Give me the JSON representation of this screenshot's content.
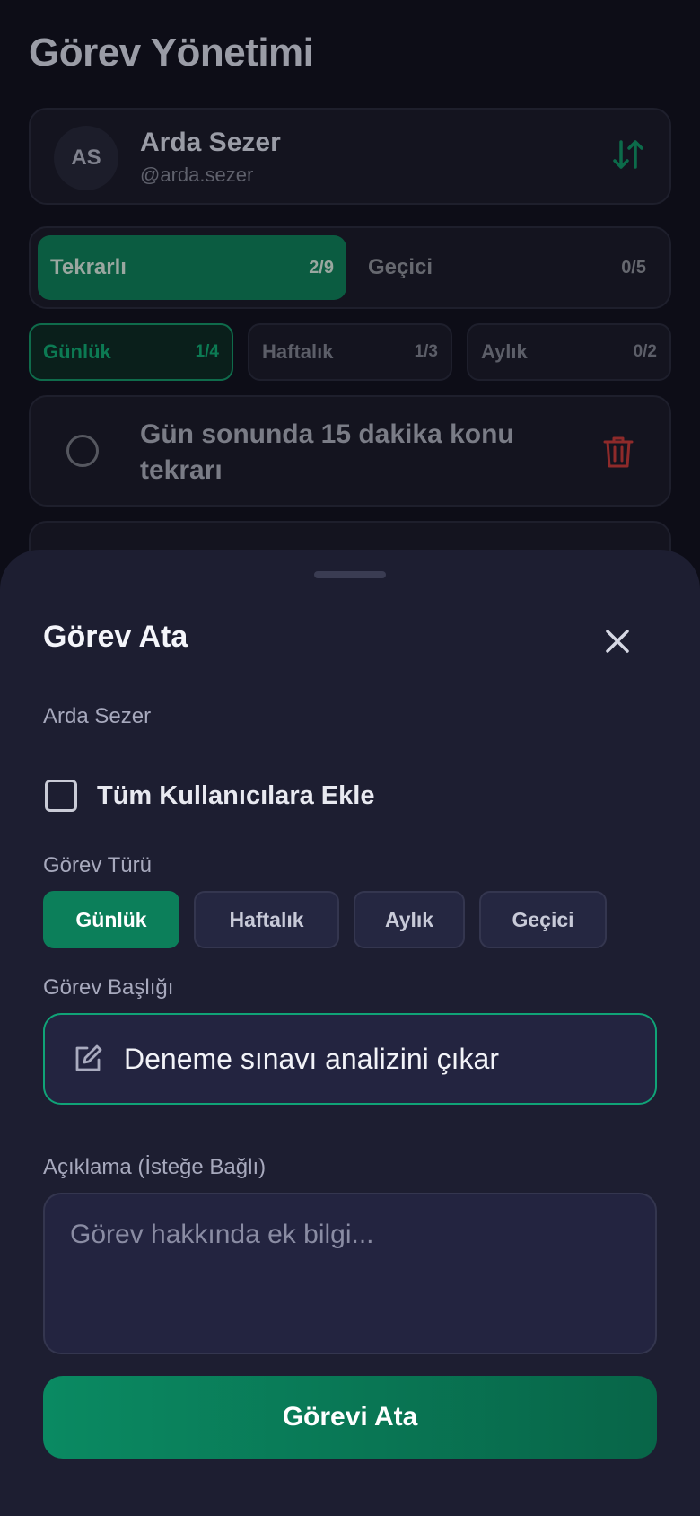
{
  "page": {
    "title": "Görev Yönetimi"
  },
  "user": {
    "initials": "AS",
    "name": "Arda Sezer",
    "handle": "@arda.sezer"
  },
  "segments": [
    {
      "label": "Tekrarlı",
      "count": "2/9",
      "active": true
    },
    {
      "label": "Geçici",
      "count": "0/5",
      "active": false
    }
  ],
  "periods": [
    {
      "label": "Günlük",
      "count": "1/4",
      "active": true
    },
    {
      "label": "Haftalık",
      "count": "1/3",
      "active": false
    },
    {
      "label": "Aylık",
      "count": "0/2",
      "active": false
    }
  ],
  "tasks": [
    {
      "text": "Gün sonunda 15 dakika konu tekrarı",
      "done": false
    }
  ],
  "sheet": {
    "title": "Görev Ata",
    "target_user": "Arda Sezer",
    "all_users_label": "Tüm Kullanıcılara Ekle",
    "all_users_checked": false,
    "type_label": "Görev Türü",
    "types": [
      "Günlük",
      "Haftalık",
      "Aylık",
      "Geçici"
    ],
    "selected_type": "Günlük",
    "title_label": "Görev Başlığı",
    "title_value": "Deneme sınavı analizini çıkar",
    "desc_label": "Açıklama (İsteğe Bağlı)",
    "desc_placeholder": "Görev hakkında ek bilgi...",
    "desc_value": "",
    "submit_label": "Görevi Ata"
  },
  "colors": {
    "accent": "#0c7f5a",
    "accent_border": "#10a377",
    "sheet_bg": "#1d1e31",
    "page_bg": "#0d0d17",
    "danger": "#c0392b"
  },
  "icons": {
    "sort": "sort-arrows-icon",
    "delete": "trash-icon",
    "close": "close-icon",
    "edit": "edit-icon"
  }
}
